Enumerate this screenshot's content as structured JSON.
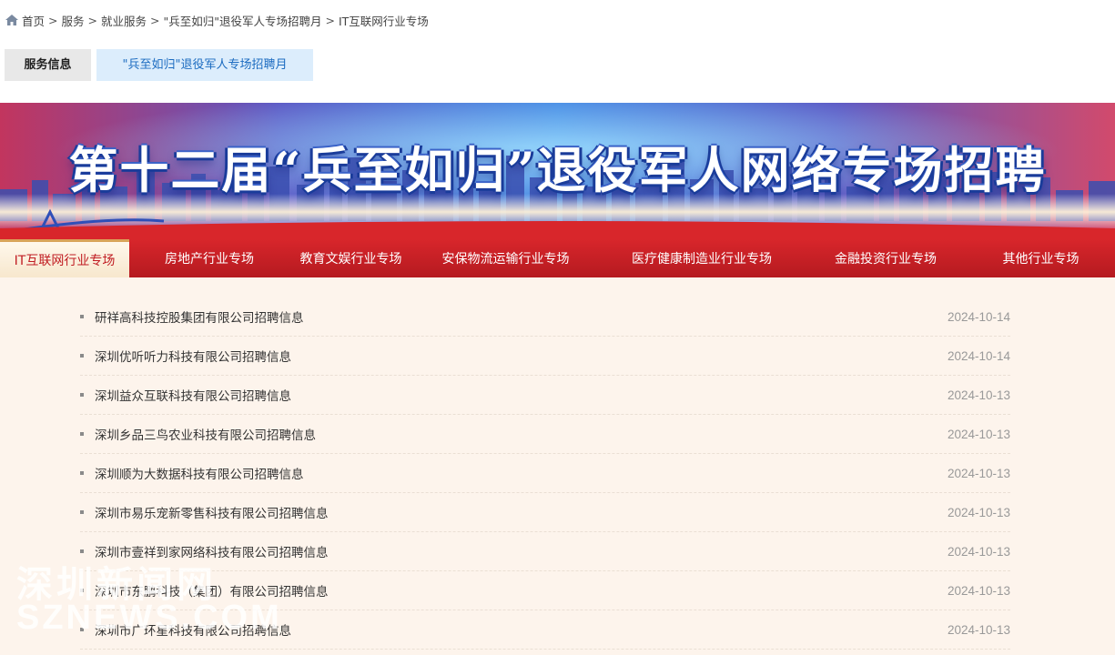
{
  "breadcrumb": {
    "items": [
      "首页",
      "服务",
      "就业服务",
      "\"兵至如归\"退役军人专场招聘月",
      "IT互联网行业专场"
    ],
    "separator": ">"
  },
  "subtabs": {
    "service_info": "服务信息",
    "campaign": "\"兵至如归\"退役军人专场招聘月"
  },
  "banner": {
    "title": "第十二届“兵至如归”退役军人网络专场招聘"
  },
  "categories": [
    "IT互联网行业专场",
    "房地产行业专场",
    "教育文娱行业专场",
    "安保物流运输行业专场",
    "医疗健康制造业行业专场",
    "金融投资行业专场",
    "其他行业专场"
  ],
  "active_category": "IT互联网行业专场",
  "news": [
    {
      "title": "研祥高科技控股集团有限公司招聘信息",
      "date": "2024-10-14"
    },
    {
      "title": "深圳优听听力科技有限公司招聘信息",
      "date": "2024-10-14"
    },
    {
      "title": "深圳益众互联科技有限公司招聘信息",
      "date": "2024-10-13"
    },
    {
      "title": "深圳乡品三鸟农业科技有限公司招聘信息",
      "date": "2024-10-13"
    },
    {
      "title": "深圳顺为大数据科技有限公司招聘信息",
      "date": "2024-10-13"
    },
    {
      "title": "深圳市易乐宠新零售科技有限公司招聘信息",
      "date": "2024-10-13"
    },
    {
      "title": "深圳市壹祥到家网络科技有限公司招聘信息",
      "date": "2024-10-13"
    },
    {
      "title": "深圳市东鹏科技（集团）有限公司招聘信息",
      "date": "2024-10-13"
    },
    {
      "title": "深圳市广环星科技有限公司招聘信息",
      "date": "2024-10-13"
    }
  ],
  "watermark": {
    "cn": "深圳新闻网",
    "en": "SZNEWS.COM"
  },
  "colors": {
    "nav_red": "#d8262b",
    "active_tab": "#c01c22",
    "link_blue": "#1b6bc0",
    "content_bg": "#fdf4ec"
  }
}
